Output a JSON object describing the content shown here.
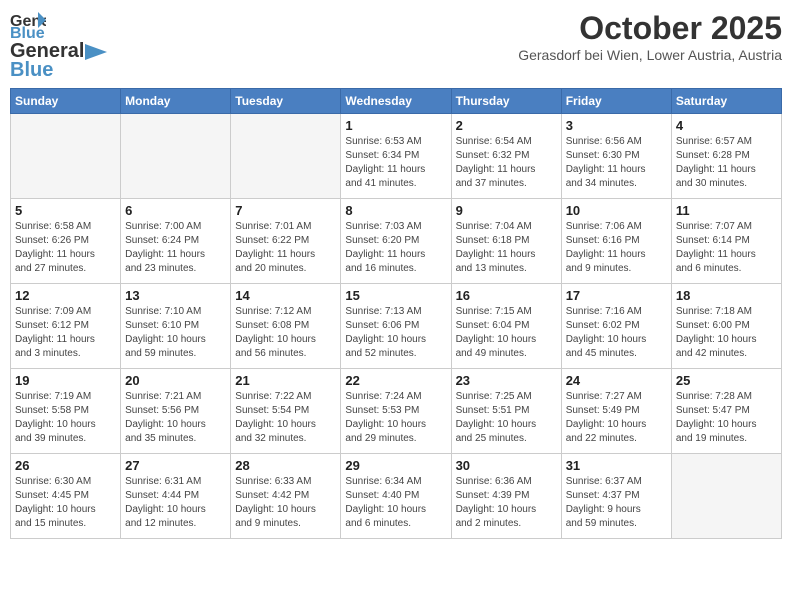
{
  "header": {
    "logo_general": "General",
    "logo_blue": "Blue",
    "month": "October 2025",
    "location": "Gerasdorf bei Wien, Lower Austria, Austria"
  },
  "days_of_week": [
    "Sunday",
    "Monday",
    "Tuesday",
    "Wednesday",
    "Thursday",
    "Friday",
    "Saturday"
  ],
  "weeks": [
    [
      {
        "day": "",
        "info": ""
      },
      {
        "day": "",
        "info": ""
      },
      {
        "day": "",
        "info": ""
      },
      {
        "day": "1",
        "info": "Sunrise: 6:53 AM\nSunset: 6:34 PM\nDaylight: 11 hours\nand 41 minutes."
      },
      {
        "day": "2",
        "info": "Sunrise: 6:54 AM\nSunset: 6:32 PM\nDaylight: 11 hours\nand 37 minutes."
      },
      {
        "day": "3",
        "info": "Sunrise: 6:56 AM\nSunset: 6:30 PM\nDaylight: 11 hours\nand 34 minutes."
      },
      {
        "day": "4",
        "info": "Sunrise: 6:57 AM\nSunset: 6:28 PM\nDaylight: 11 hours\nand 30 minutes."
      }
    ],
    [
      {
        "day": "5",
        "info": "Sunrise: 6:58 AM\nSunset: 6:26 PM\nDaylight: 11 hours\nand 27 minutes."
      },
      {
        "day": "6",
        "info": "Sunrise: 7:00 AM\nSunset: 6:24 PM\nDaylight: 11 hours\nand 23 minutes."
      },
      {
        "day": "7",
        "info": "Sunrise: 7:01 AM\nSunset: 6:22 PM\nDaylight: 11 hours\nand 20 minutes."
      },
      {
        "day": "8",
        "info": "Sunrise: 7:03 AM\nSunset: 6:20 PM\nDaylight: 11 hours\nand 16 minutes."
      },
      {
        "day": "9",
        "info": "Sunrise: 7:04 AM\nSunset: 6:18 PM\nDaylight: 11 hours\nand 13 minutes."
      },
      {
        "day": "10",
        "info": "Sunrise: 7:06 AM\nSunset: 6:16 PM\nDaylight: 11 hours\nand 9 minutes."
      },
      {
        "day": "11",
        "info": "Sunrise: 7:07 AM\nSunset: 6:14 PM\nDaylight: 11 hours\nand 6 minutes."
      }
    ],
    [
      {
        "day": "12",
        "info": "Sunrise: 7:09 AM\nSunset: 6:12 PM\nDaylight: 11 hours\nand 3 minutes."
      },
      {
        "day": "13",
        "info": "Sunrise: 7:10 AM\nSunset: 6:10 PM\nDaylight: 10 hours\nand 59 minutes."
      },
      {
        "day": "14",
        "info": "Sunrise: 7:12 AM\nSunset: 6:08 PM\nDaylight: 10 hours\nand 56 minutes."
      },
      {
        "day": "15",
        "info": "Sunrise: 7:13 AM\nSunset: 6:06 PM\nDaylight: 10 hours\nand 52 minutes."
      },
      {
        "day": "16",
        "info": "Sunrise: 7:15 AM\nSunset: 6:04 PM\nDaylight: 10 hours\nand 49 minutes."
      },
      {
        "day": "17",
        "info": "Sunrise: 7:16 AM\nSunset: 6:02 PM\nDaylight: 10 hours\nand 45 minutes."
      },
      {
        "day": "18",
        "info": "Sunrise: 7:18 AM\nSunset: 6:00 PM\nDaylight: 10 hours\nand 42 minutes."
      }
    ],
    [
      {
        "day": "19",
        "info": "Sunrise: 7:19 AM\nSunset: 5:58 PM\nDaylight: 10 hours\nand 39 minutes."
      },
      {
        "day": "20",
        "info": "Sunrise: 7:21 AM\nSunset: 5:56 PM\nDaylight: 10 hours\nand 35 minutes."
      },
      {
        "day": "21",
        "info": "Sunrise: 7:22 AM\nSunset: 5:54 PM\nDaylight: 10 hours\nand 32 minutes."
      },
      {
        "day": "22",
        "info": "Sunrise: 7:24 AM\nSunset: 5:53 PM\nDaylight: 10 hours\nand 29 minutes."
      },
      {
        "day": "23",
        "info": "Sunrise: 7:25 AM\nSunset: 5:51 PM\nDaylight: 10 hours\nand 25 minutes."
      },
      {
        "day": "24",
        "info": "Sunrise: 7:27 AM\nSunset: 5:49 PM\nDaylight: 10 hours\nand 22 minutes."
      },
      {
        "day": "25",
        "info": "Sunrise: 7:28 AM\nSunset: 5:47 PM\nDaylight: 10 hours\nand 19 minutes."
      }
    ],
    [
      {
        "day": "26",
        "info": "Sunrise: 6:30 AM\nSunset: 4:45 PM\nDaylight: 10 hours\nand 15 minutes."
      },
      {
        "day": "27",
        "info": "Sunrise: 6:31 AM\nSunset: 4:44 PM\nDaylight: 10 hours\nand 12 minutes."
      },
      {
        "day": "28",
        "info": "Sunrise: 6:33 AM\nSunset: 4:42 PM\nDaylight: 10 hours\nand 9 minutes."
      },
      {
        "day": "29",
        "info": "Sunrise: 6:34 AM\nSunset: 4:40 PM\nDaylight: 10 hours\nand 6 minutes."
      },
      {
        "day": "30",
        "info": "Sunrise: 6:36 AM\nSunset: 4:39 PM\nDaylight: 10 hours\nand 2 minutes."
      },
      {
        "day": "31",
        "info": "Sunrise: 6:37 AM\nSunset: 4:37 PM\nDaylight: 9 hours\nand 59 minutes."
      },
      {
        "day": "",
        "info": ""
      }
    ]
  ]
}
